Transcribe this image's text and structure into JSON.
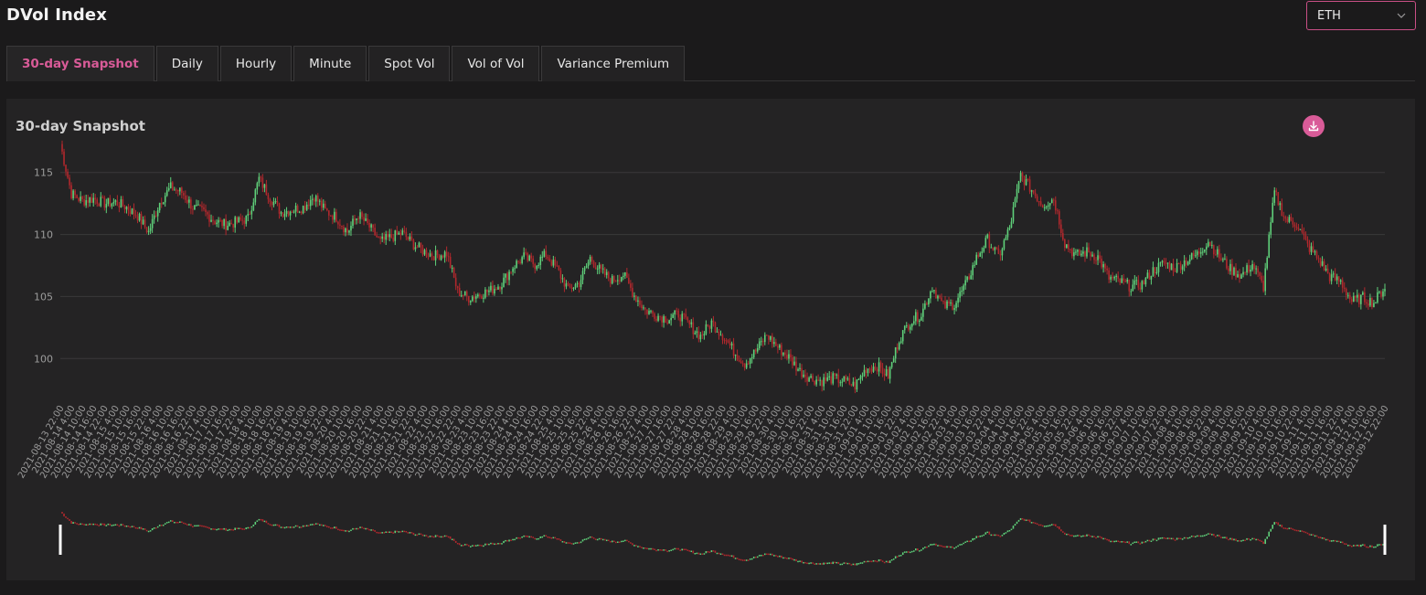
{
  "page": {
    "title": "DVol Index"
  },
  "asset_select": {
    "value": "ETH"
  },
  "tabs": [
    {
      "label": "30-day Snapshot",
      "active": true
    },
    {
      "label": "Daily",
      "active": false
    },
    {
      "label": "Hourly",
      "active": false
    },
    {
      "label": "Minute",
      "active": false
    },
    {
      "label": "Spot Vol",
      "active": false
    },
    {
      "label": "Vol of Vol",
      "active": false
    },
    {
      "label": "Variance Premium",
      "active": false
    }
  ],
  "panel": {
    "title": "30-day Snapshot"
  },
  "colors": {
    "up": "#5fd07a",
    "down": "#b0282d",
    "accent": "#d95b98",
    "grid": "#3a393a"
  },
  "icons": {
    "download": "download-icon",
    "chevron": "chevron-down-icon"
  },
  "chart_data": {
    "type": "candlestick",
    "title": "",
    "ylim": [
      97,
      118
    ],
    "y_ticks": [
      100,
      105,
      110,
      115
    ],
    "grid": "horizontal",
    "x_tick_labels": [
      "2021-08-13 22:00",
      "2021-08-14 4:00",
      "2021-08-14 10:00",
      "2021-08-14 16:00",
      "2021-08-14 22:00",
      "2021-08-15 4:00",
      "2021-08-15 10:00",
      "2021-08-15 16:00",
      "2021-08-15 22:00",
      "2021-08-16 4:00",
      "2021-08-16 10:00",
      "2021-08-16 16:00",
      "2021-08-16 22:00",
      "2021-08-17 4:00",
      "2021-08-17 10:00",
      "2021-08-17 16:00",
      "2021-08-17 22:00",
      "2021-08-18 4:00",
      "2021-08-18 10:00",
      "2021-08-18 16:00",
      "2021-08-18 22:00",
      "2021-08-19 4:00",
      "2021-08-19 10:00",
      "2021-08-19 16:00",
      "2021-08-19 22:00",
      "2021-08-20 4:00",
      "2021-08-20 10:00",
      "2021-08-20 16:00",
      "2021-08-20 22:00",
      "2021-08-21 4:00",
      "2021-08-21 10:00",
      "2021-08-21 16:00",
      "2021-08-21 22:00",
      "2021-08-22 4:00",
      "2021-08-22 10:00",
      "2021-08-22 16:00",
      "2021-08-22 22:00",
      "2021-08-23 4:00",
      "2021-08-23 10:00",
      "2021-08-23 16:00",
      "2021-08-23 22:00",
      "2021-08-24 4:00",
      "2021-08-24 10:00",
      "2021-08-24 16:00",
      "2021-08-24 22:00",
      "2021-08-25 4:00",
      "2021-08-25 10:00",
      "2021-08-25 16:00",
      "2021-08-25 22:00",
      "2021-08-26 4:00",
      "2021-08-26 10:00",
      "2021-08-26 16:00",
      "2021-08-26 22:00",
      "2021-08-27 4:00",
      "2021-08-27 10:00",
      "2021-08-27 16:00",
      "2021-08-27 22:00",
      "2021-08-28 4:00",
      "2021-08-28 10:00",
      "2021-08-28 16:00",
      "2021-08-28 22:00",
      "2021-08-29 4:00",
      "2021-08-29 10:00",
      "2021-08-29 16:00",
      "2021-08-29 22:00",
      "2021-08-30 4:00",
      "2021-08-30 10:00",
      "2021-08-30 16:00",
      "2021-08-30 22:00",
      "2021-08-31 4:00",
      "2021-08-31 10:00",
      "2021-08-31 16:00",
      "2021-08-31 22:00",
      "2021-09-01 4:00",
      "2021-09-01 10:00",
      "2021-09-01 16:00",
      "2021-09-01 22:00",
      "2021-09-02 4:00",
      "2021-09-02 10:00",
      "2021-09-02 16:00",
      "2021-09-02 22:00",
      "2021-09-03 4:00",
      "2021-09-03 10:00",
      "2021-09-03 16:00",
      "2021-09-03 22:00",
      "2021-09-04 4:00",
      "2021-09-04 10:00",
      "2021-09-04 16:00",
      "2021-09-04 22:00",
      "2021-09-05 4:00",
      "2021-09-05 10:00",
      "2021-09-05 16:00",
      "2021-09-05 22:00",
      "2021-09-06 4:00",
      "2021-09-06 10:00",
      "2021-09-06 16:00",
      "2021-09-06 22:00",
      "2021-09-07 4:00",
      "2021-09-07 10:00",
      "2021-09-07 16:00",
      "2021-09-07 22:00",
      "2021-09-08 4:00",
      "2021-09-08 10:00",
      "2021-09-08 16:00",
      "2021-09-08 22:00",
      "2021-09-09 4:00",
      "2021-09-09 10:00",
      "2021-09-09 16:00",
      "2021-09-09 22:00",
      "2021-09-10 4:00",
      "2021-09-10 10:00",
      "2021-09-10 16:00",
      "2021-09-10 22:00",
      "2021-09-11 4:00",
      "2021-09-11 10:00",
      "2021-09-11 16:00",
      "2021-09-11 22:00",
      "2021-09-12 4:00",
      "2021-09-12 10:00",
      "2021-09-12 16:00",
      "2021-09-12 22:00"
    ],
    "series": [
      {
        "x": "2021-08-13 22:00",
        "close": 117.3
      },
      {
        "x": "2021-08-14 4:00",
        "close": 113.3
      },
      {
        "x": "2021-08-14 10:00",
        "close": 112.7
      },
      {
        "x": "2021-08-14 16:00",
        "close": 112.9
      },
      {
        "x": "2021-08-14 22:00",
        "close": 112.5
      },
      {
        "x": "2021-08-15 4:00",
        "close": 112.6
      },
      {
        "x": "2021-08-15 10:00",
        "close": 112.2
      },
      {
        "x": "2021-08-15 16:00",
        "close": 111.5
      },
      {
        "x": "2021-08-15 22:00",
        "close": 110.2
      },
      {
        "x": "2021-08-16 4:00",
        "close": 112.6
      },
      {
        "x": "2021-08-16 10:00",
        "close": 113.8
      },
      {
        "x": "2021-08-16 16:00",
        "close": 113.4
      },
      {
        "x": "2021-08-16 22:00",
        "close": 112.2
      },
      {
        "x": "2021-08-17 4:00",
        "close": 111.8
      },
      {
        "x": "2021-08-17 10:00",
        "close": 111.1
      },
      {
        "x": "2021-08-17 16:00",
        "close": 110.8
      },
      {
        "x": "2021-08-17 22:00",
        "close": 111.0
      },
      {
        "x": "2021-08-18 4:00",
        "close": 111.3
      },
      {
        "x": "2021-08-18 10:00",
        "close": 114.5
      },
      {
        "x": "2021-08-18 16:00",
        "close": 113.0
      },
      {
        "x": "2021-08-18 22:00",
        "close": 111.8
      },
      {
        "x": "2021-08-19 4:00",
        "close": 112.0
      },
      {
        "x": "2021-08-19 10:00",
        "close": 112.2
      },
      {
        "x": "2021-08-19 16:00",
        "close": 113.1
      },
      {
        "x": "2021-08-19 22:00",
        "close": 111.9
      },
      {
        "x": "2021-08-20 4:00",
        "close": 111.4
      },
      {
        "x": "2021-08-20 10:00",
        "close": 110.2
      },
      {
        "x": "2021-08-20 16:00",
        "close": 111.6
      },
      {
        "x": "2021-08-20 22:00",
        "close": 110.6
      },
      {
        "x": "2021-08-21 4:00",
        "close": 109.4
      },
      {
        "x": "2021-08-21 10:00",
        "close": 109.8
      },
      {
        "x": "2021-08-21 16:00",
        "close": 110.1
      },
      {
        "x": "2021-08-21 22:00",
        "close": 109.2
      },
      {
        "x": "2021-08-22 4:00",
        "close": 108.6
      },
      {
        "x": "2021-08-22 10:00",
        "close": 108.3
      },
      {
        "x": "2021-08-22 16:00",
        "close": 108.5
      },
      {
        "x": "2021-08-22 22:00",
        "close": 105.4
      },
      {
        "x": "2021-08-23 4:00",
        "close": 104.9
      },
      {
        "x": "2021-08-23 10:00",
        "close": 105.2
      },
      {
        "x": "2021-08-23 16:00",
        "close": 105.5
      },
      {
        "x": "2021-08-23 22:00",
        "close": 106.1
      },
      {
        "x": "2021-08-24 4:00",
        "close": 107.4
      },
      {
        "x": "2021-08-24 10:00",
        "close": 108.2
      },
      {
        "x": "2021-08-24 16:00",
        "close": 107.6
      },
      {
        "x": "2021-08-24 22:00",
        "close": 108.4
      },
      {
        "x": "2021-08-25 4:00",
        "close": 107.2
      },
      {
        "x": "2021-08-25 10:00",
        "close": 105.6
      },
      {
        "x": "2021-08-25 16:00",
        "close": 106.1
      },
      {
        "x": "2021-08-25 22:00",
        "close": 108.1
      },
      {
        "x": "2021-08-26 4:00",
        "close": 107.0
      },
      {
        "x": "2021-08-26 10:00",
        "close": 106.3
      },
      {
        "x": "2021-08-26 16:00",
        "close": 106.8
      },
      {
        "x": "2021-08-26 22:00",
        "close": 105.1
      },
      {
        "x": "2021-08-27 4:00",
        "close": 103.9
      },
      {
        "x": "2021-08-27 10:00",
        "close": 103.5
      },
      {
        "x": "2021-08-27 16:00",
        "close": 103.2
      },
      {
        "x": "2021-08-27 22:00",
        "close": 103.6
      },
      {
        "x": "2021-08-28 4:00",
        "close": 102.7
      },
      {
        "x": "2021-08-28 10:00",
        "close": 101.8
      },
      {
        "x": "2021-08-28 16:00",
        "close": 102.9
      },
      {
        "x": "2021-08-28 22:00",
        "close": 101.9
      },
      {
        "x": "2021-08-29 4:00",
        "close": 100.6
      },
      {
        "x": "2021-08-29 10:00",
        "close": 99.6
      },
      {
        "x": "2021-08-29 16:00",
        "close": 100.6
      },
      {
        "x": "2021-08-29 22:00",
        "close": 101.9
      },
      {
        "x": "2021-08-30 4:00",
        "close": 100.9
      },
      {
        "x": "2021-08-30 10:00",
        "close": 100.1
      },
      {
        "x": "2021-08-30 16:00",
        "close": 99.0
      },
      {
        "x": "2021-08-30 22:00",
        "close": 98.4
      },
      {
        "x": "2021-08-31 4:00",
        "close": 98.2
      },
      {
        "x": "2021-08-31 10:00",
        "close": 98.4
      },
      {
        "x": "2021-08-31 16:00",
        "close": 98.2
      },
      {
        "x": "2021-08-31 22:00",
        "close": 97.8
      },
      {
        "x": "2021-09-01 4:00",
        "close": 99.2
      },
      {
        "x": "2021-09-01 10:00",
        "close": 99.4
      },
      {
        "x": "2021-09-01 16:00",
        "close": 98.6
      },
      {
        "x": "2021-09-01 22:00",
        "close": 101.6
      },
      {
        "x": "2021-09-02 4:00",
        "close": 103.0
      },
      {
        "x": "2021-09-02 10:00",
        "close": 103.6
      },
      {
        "x": "2021-09-02 16:00",
        "close": 105.8
      },
      {
        "x": "2021-09-02 22:00",
        "close": 104.2
      },
      {
        "x": "2021-09-03 4:00",
        "close": 104.4
      },
      {
        "x": "2021-09-03 10:00",
        "close": 105.9
      },
      {
        "x": "2021-09-03 16:00",
        "close": 108.1
      },
      {
        "x": "2021-09-03 22:00",
        "close": 109.6
      },
      {
        "x": "2021-09-04 4:00",
        "close": 108.2
      },
      {
        "x": "2021-09-04 10:00",
        "close": 110.5
      },
      {
        "x": "2021-09-04 16:00",
        "close": 114.8
      },
      {
        "x": "2021-09-04 22:00",
        "close": 113.6
      },
      {
        "x": "2021-09-05 4:00",
        "close": 112.4
      },
      {
        "x": "2021-09-05 10:00",
        "close": 112.9
      },
      {
        "x": "2021-09-05 16:00",
        "close": 109.3
      },
      {
        "x": "2021-09-05 22:00",
        "close": 108.3
      },
      {
        "x": "2021-09-06 4:00",
        "close": 108.6
      },
      {
        "x": "2021-09-06 10:00",
        "close": 108.2
      },
      {
        "x": "2021-09-06 16:00",
        "close": 106.5
      },
      {
        "x": "2021-09-06 22:00",
        "close": 106.2
      },
      {
        "x": "2021-09-07 4:00",
        "close": 105.8
      },
      {
        "x": "2021-09-07 10:00",
        "close": 106.0
      },
      {
        "x": "2021-09-07 16:00",
        "close": 107.1
      },
      {
        "x": "2021-09-07 22:00",
        "close": 107.7
      },
      {
        "x": "2021-09-08 4:00",
        "close": 107.3
      },
      {
        "x": "2021-09-08 10:00",
        "close": 107.9
      },
      {
        "x": "2021-09-08 16:00",
        "close": 108.4
      },
      {
        "x": "2021-09-08 22:00",
        "close": 109.5
      },
      {
        "x": "2021-09-09 4:00",
        "close": 108.2
      },
      {
        "x": "2021-09-09 10:00",
        "close": 107.2
      },
      {
        "x": "2021-09-09 16:00",
        "close": 106.7
      },
      {
        "x": "2021-09-09 22:00",
        "close": 107.6
      },
      {
        "x": "2021-09-10 4:00",
        "close": 105.8
      },
      {
        "x": "2021-09-10 10:00",
        "close": 113.4
      },
      {
        "x": "2021-09-10 16:00",
        "close": 111.2
      },
      {
        "x": "2021-09-10 22:00",
        "close": 110.9
      },
      {
        "x": "2021-09-11 4:00",
        "close": 109.1
      },
      {
        "x": "2021-09-11 10:00",
        "close": 108.0
      },
      {
        "x": "2021-09-11 16:00",
        "close": 106.6
      },
      {
        "x": "2021-09-11 22:00",
        "close": 106.2
      },
      {
        "x": "2021-09-12 4:00",
        "close": 104.6
      },
      {
        "x": "2021-09-12 10:00",
        "close": 104.9
      },
      {
        "x": "2021-09-12 16:00",
        "close": 104.5
      },
      {
        "x": "2021-09-12 22:00",
        "close": 105.8
      }
    ]
  }
}
